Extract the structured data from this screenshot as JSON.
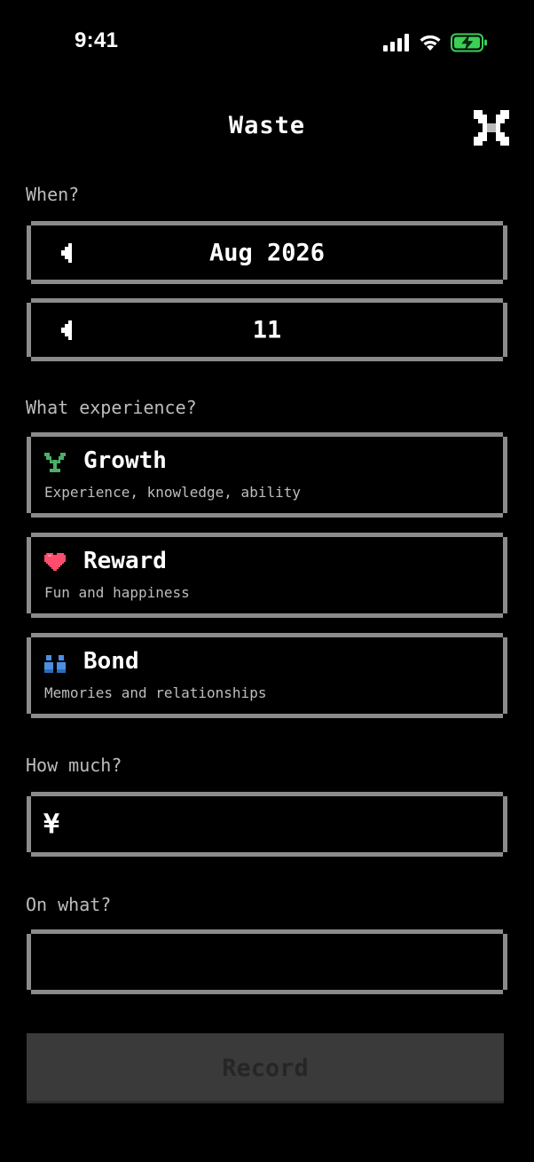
{
  "status_bar": {
    "time": "9:41",
    "battery_color": "#3ccf57"
  },
  "header": {
    "title": "Waste",
    "close_icon": "close-icon"
  },
  "when": {
    "label": "When?",
    "month_value": "Aug 2026",
    "day_value": "11",
    "arrow_icon": "triangle-left-icon"
  },
  "experience": {
    "label": "What experience?",
    "options": [
      {
        "title": "Growth",
        "description": "Experience, knowledge, ability",
        "icon": "sprout-icon",
        "color": "#4caf68"
      },
      {
        "title": "Reward",
        "description": "Fun and happiness",
        "icon": "heart-icon",
        "color": "#ff4d6d"
      },
      {
        "title": "Bond",
        "description": "Memories and relationships",
        "icon": "people-icon",
        "color": "#4a90e2"
      }
    ]
  },
  "amount": {
    "label": "How much?",
    "currency": "¥",
    "value": ""
  },
  "purpose": {
    "label": "On what?",
    "value": ""
  },
  "record_button": {
    "label": "Record"
  },
  "colors": {
    "background": "#000000",
    "border": "#8b8b8b",
    "label": "#bdbdbd",
    "button_disabled": "#3a3a3a"
  }
}
